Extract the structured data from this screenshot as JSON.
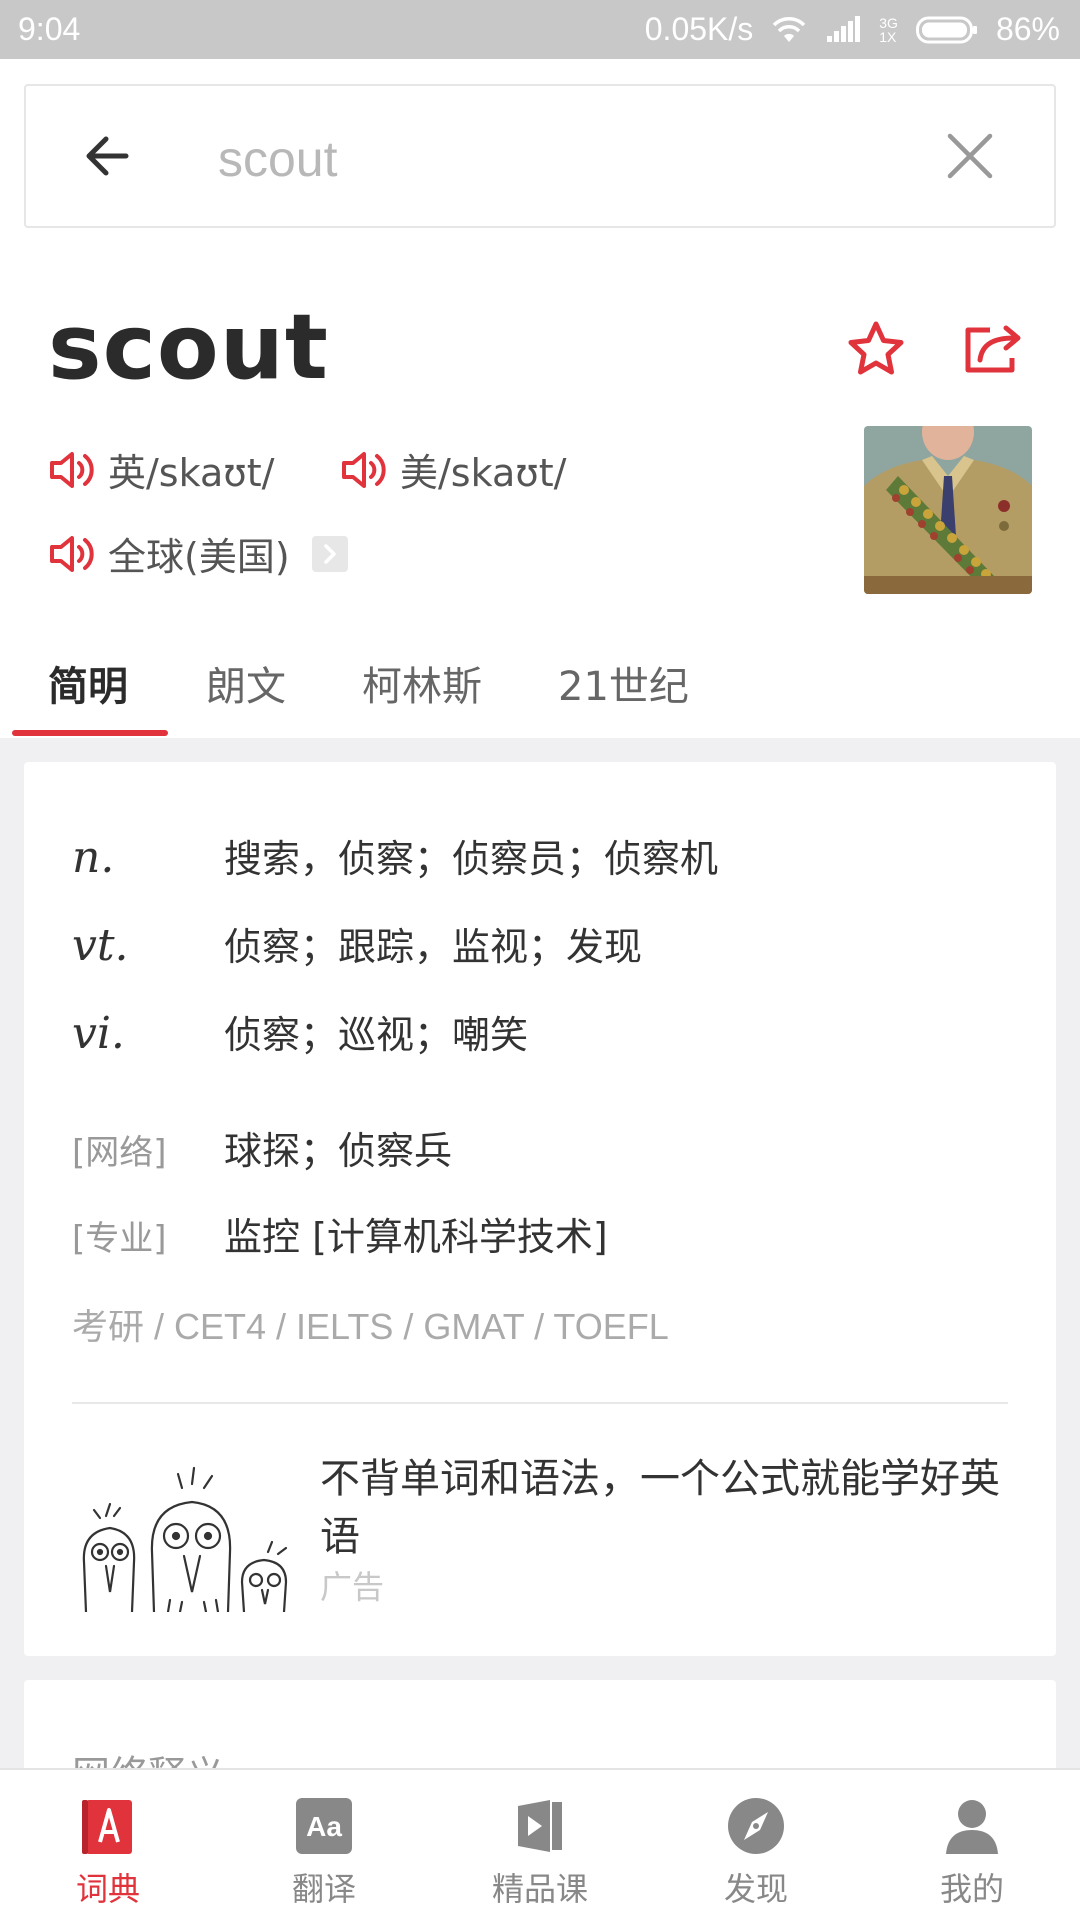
{
  "status_bar": {
    "time": "9:04",
    "net_speed": "0.05K/s",
    "network": "3G",
    "sim": "1X",
    "battery": "86%"
  },
  "search": {
    "query": "scout"
  },
  "word": {
    "headword": "scout",
    "pron_uk": "英/skaʊt/",
    "pron_us": "美/skaʊt/",
    "pron_global": "全球(美国)"
  },
  "tabs": [
    {
      "label": "简明"
    },
    {
      "label": "朗文"
    },
    {
      "label": "柯林斯"
    },
    {
      "label": "21世纪"
    }
  ],
  "definitions": [
    {
      "pos": "n.",
      "text": "搜索，侦察；侦察员；侦察机"
    },
    {
      "pos": "vt.",
      "text": "侦察；跟踪，监视；发现"
    },
    {
      "pos": "vi.",
      "text": "侦察；巡视；嘲笑"
    }
  ],
  "extra": [
    {
      "tag": "[网络]",
      "text": "球探；侦察兵"
    },
    {
      "tag": "[专业]",
      "text": "监控 [计算机科学技术]"
    }
  ],
  "exams": "考研 / CET4 / IELTS / GMAT / TOEFL",
  "ad": {
    "title": "不背单词和语法，一个公式就能学好英语",
    "label": "广告"
  },
  "web_section": {
    "title": "网络释义"
  },
  "bottom_nav": [
    {
      "label": "词典",
      "icon": "dictionary-icon"
    },
    {
      "label": "翻译",
      "icon": "translate-icon"
    },
    {
      "label": "精品课",
      "icon": "course-icon"
    },
    {
      "label": "发现",
      "icon": "compass-icon"
    },
    {
      "label": "我的",
      "icon": "profile-icon"
    }
  ],
  "colors": {
    "accent": "#e0333c",
    "status_bar": "#c8c8c8",
    "background": "#f0f0f2"
  }
}
